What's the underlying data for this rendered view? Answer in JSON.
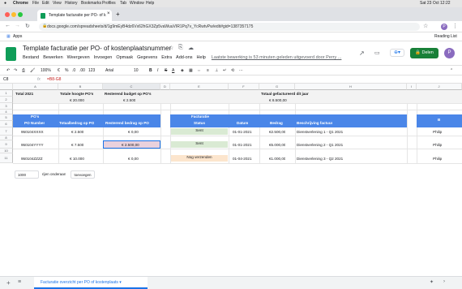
{
  "macos": {
    "app": "Chrome",
    "menu": [
      "File",
      "Edit",
      "View",
      "History",
      "Bookmarks",
      "Profiles",
      "Tab",
      "Window",
      "Help"
    ],
    "clock": "Sat 23 Oct  12:22"
  },
  "browser": {
    "tab_title": "Template facturatie per PO- of k",
    "url": "docs.google.com/spreadsheets/d/1g9mEyB4dz6Vx62hGX3Zp5vaWuuVIR1Pq7v_YcRwtvPw/edit#gid=1387357175",
    "bookmarks": [
      "Apps"
    ],
    "reading_list": "Reading List"
  },
  "sheets": {
    "title": "Template facturatie per PO- of kostenplaatsnummer",
    "menus": [
      "Bestand",
      "Bewerken",
      "Weergeven",
      "Invoegen",
      "Opmaak",
      "Gegevens",
      "Extra",
      "Add-ons",
      "Help"
    ],
    "last_edit": "Laatste bewerking is 53 minuten geleden uitgevoerd door Perry ...",
    "share_label": "Delen",
    "share_avatar": "P",
    "toolbar": {
      "zoom": "100%",
      "currency": "€",
      "percent": "%",
      "dec1": ".0",
      "dec2": ".00",
      "format": "123",
      "font": "Arial",
      "size": "10",
      "bold": "B",
      "italic": "I",
      "strike": "S",
      "color": "A"
    },
    "name_box": "C8",
    "fx": "fx",
    "formula": "=B8-G8"
  },
  "columns": [
    "A",
    "B",
    "C",
    "D",
    "E",
    "F",
    "G",
    "H",
    "I",
    "J"
  ],
  "rows": [
    "1",
    "2",
    "3",
    "4",
    "5",
    "6",
    "7",
    "8",
    "9",
    "10",
    "11"
  ],
  "summary": {
    "total_label": "Total 2021",
    "po_height_label": "Totale hoogte PO's",
    "po_height_value": "€ 20.000",
    "remaining_label": "Resterend budget op PO's",
    "remaining_value": "€ 2.500",
    "invoiced_label": "Totaal gefactureerd dit jaar",
    "invoiced_value": "€ 8.500,00"
  },
  "headers": {
    "po_top": "PO's",
    "po_number": "PO Number",
    "po_amount": "Totaalbedrag op PO",
    "po_remaining": "Resterend bedrag op PO",
    "invoice_top": "Facturatie",
    "invoice_status": "Status",
    "date": "Datum",
    "amount": "Bedrag",
    "description": "Beschrijving factuur",
    "extra": "B"
  },
  "po_rows": [
    {
      "po": "950104XXXX",
      "total": "€ 2.500",
      "remaining": "€ 0,00",
      "status": "Sent",
      "date": "01-01-2021",
      "amount": "€2.500,00",
      "desc": "Dienstverlening 1 - Q1 2021",
      "extra": "Philip"
    },
    {
      "po": "950104YYYY",
      "total": "€ 7.500",
      "remaining": "€ 2.500,00",
      "status": "Sent",
      "date": "01-01-2021",
      "amount": "€5.000,00",
      "desc": "Dienstverlening 2 - Q1 2021",
      "extra": "Philip"
    },
    {
      "po": "950104ZZZZ",
      "total": "€ 10.000",
      "remaining": "€ 0,00",
      "status": "Nog verzenden",
      "date": "01-04-2021",
      "amount": "€1.000,00",
      "desc": "Dienstverlening 3 - Q2 2021",
      "extra": "Philip"
    }
  ],
  "add_rows": {
    "count": "1000",
    "label": "rijen onderaan",
    "button": "toevoegen"
  },
  "sheet_tab": "Facturatie overzicht per PO of kostenplaats",
  "colors": {
    "blue_header": "#4a86e8",
    "status_sent": "#d9ead3",
    "status_pending": "#fce5cd",
    "selection": "#1a73e8",
    "share_green": "#188038"
  }
}
